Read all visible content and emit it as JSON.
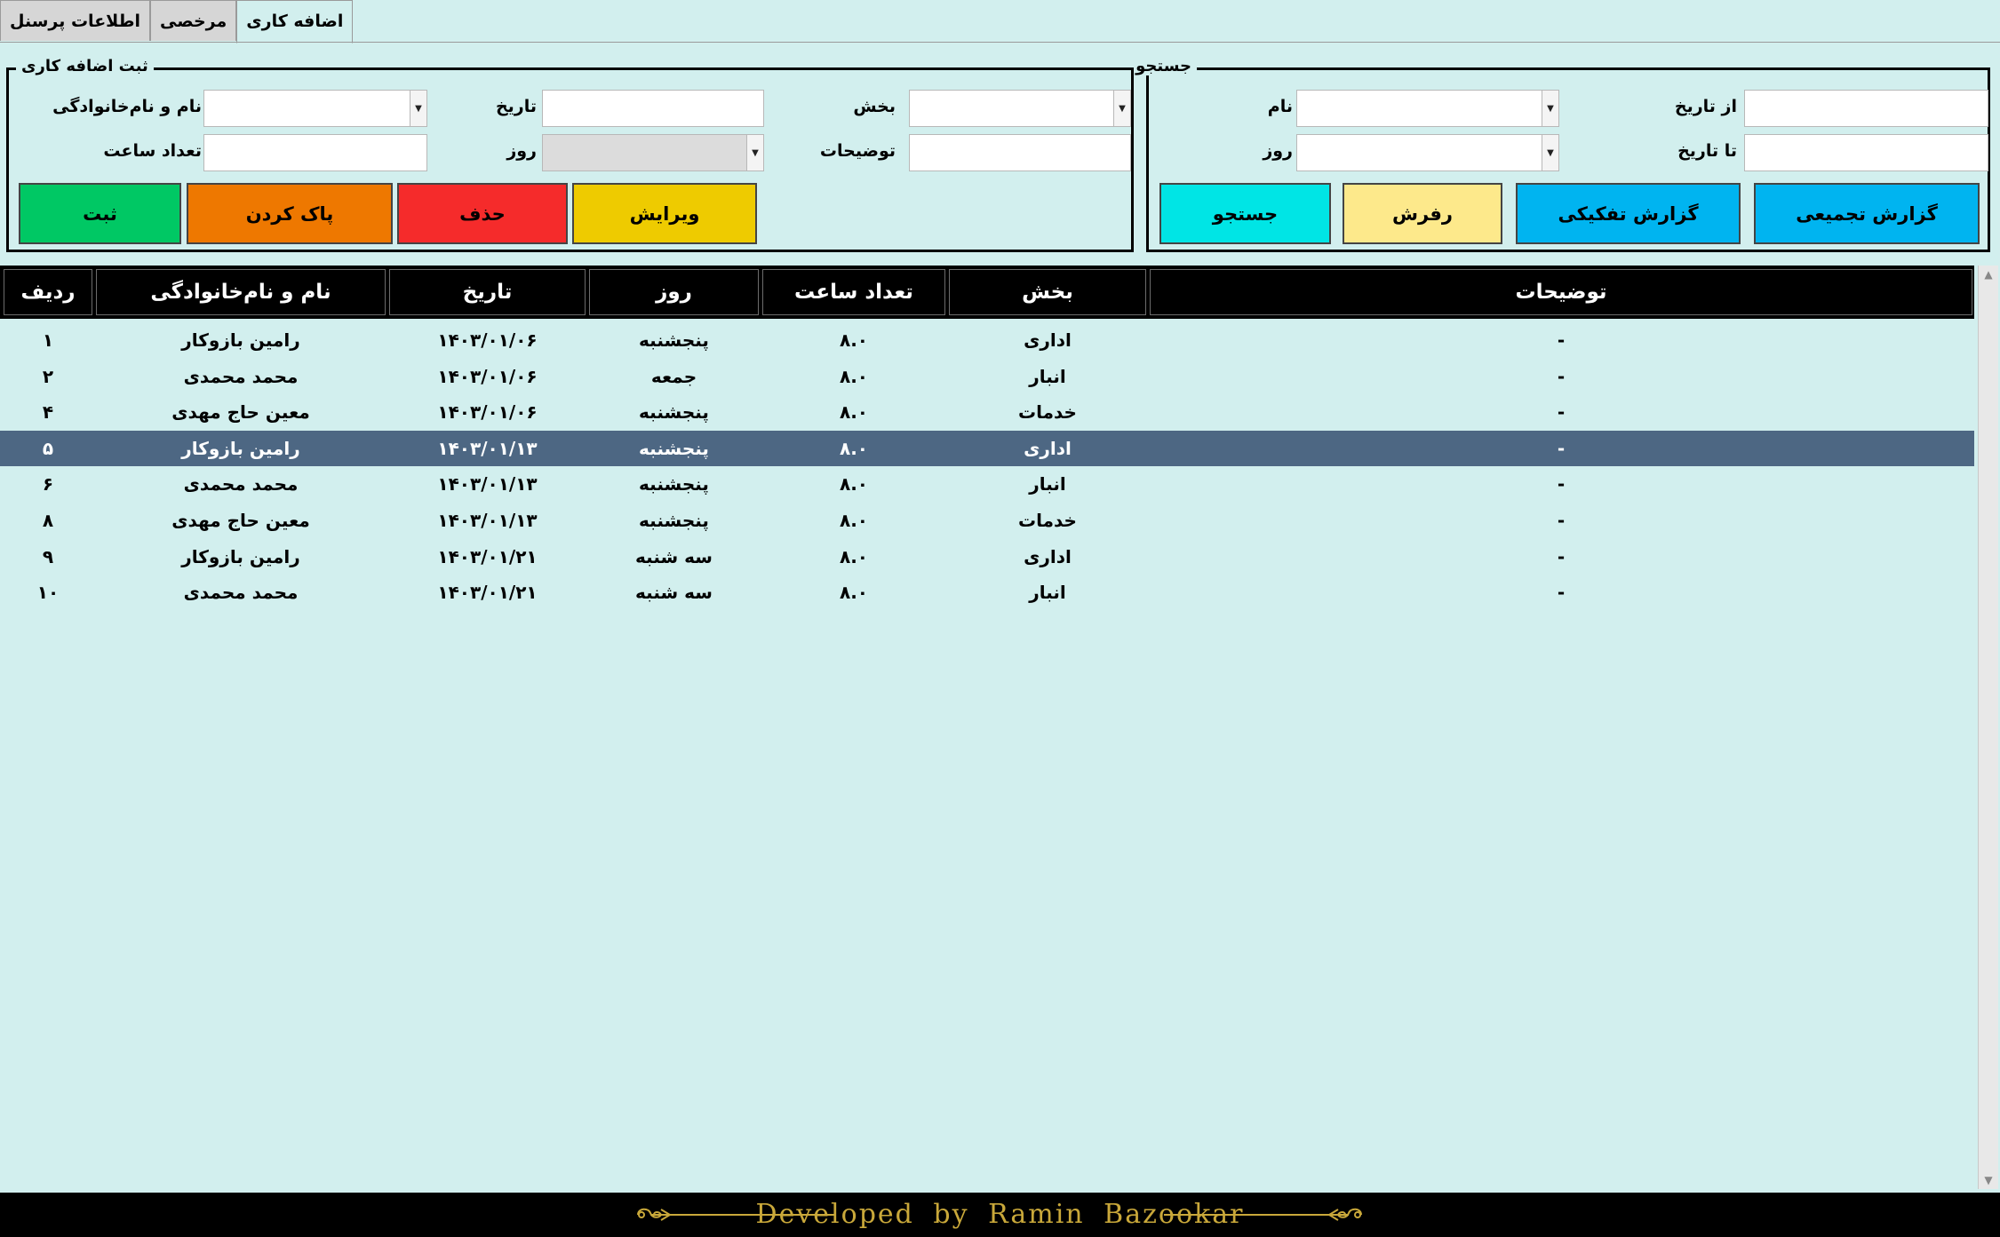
{
  "tabs": [
    {
      "label": "اطلاعات پرسنل"
    },
    {
      "label": "مرخصی"
    },
    {
      "label": "اضافه کاری"
    }
  ],
  "search": {
    "title": "جستجو",
    "from_date_label": "از تاریخ",
    "to_date_label": "تا تاریخ",
    "name_label": "نام",
    "day_label": "روز",
    "from_date_value": "",
    "to_date_value": "",
    "name_value": "",
    "day_value": "",
    "buttons": {
      "summary": "گزارش تجمیعی",
      "detailed": "گزارش تفکیکی",
      "refresh": "رفرش",
      "search": "جستجو"
    },
    "colors": {
      "summary": "#00b4f0",
      "detailed": "#00b4f0",
      "refresh": "#fde98b",
      "search": "#00e5e5"
    }
  },
  "entry": {
    "title": "ثبت اضافه کاری",
    "dept_label": "بخش",
    "desc_label": "توضیحات",
    "date_label": "تاریخ",
    "day_label": "روز",
    "name_label": "نام و نام‌خانوادگی",
    "hours_label": "تعداد ساعت",
    "dept_value": "",
    "desc_value": "",
    "date_value": "",
    "day_value": "",
    "name_value": "",
    "hours_value": "",
    "buttons": {
      "edit": "ویرایش",
      "delete": "حذف",
      "clear": "پاک کردن",
      "submit": "ثبت"
    },
    "colors": {
      "edit": "#eecb00",
      "delete": "#f52b2b",
      "clear": "#ee7800",
      "submit": "#00c864"
    }
  },
  "table": {
    "columns": {
      "desc": "توضیحات",
      "dept": "بخش",
      "hours": "تعداد ساعت",
      "day": "روز",
      "date": "تاریخ",
      "name": "نام و نام‌خانوادگی",
      "row": "ردیف"
    },
    "rows": [
      {
        "desc": "-",
        "dept": "اداری",
        "hours": "۸.۰",
        "day": "پنجشنبه",
        "date": "۱۴۰۳/۰۱/۰۶",
        "name": "رامین بازوکار",
        "row": "۱"
      },
      {
        "desc": "-",
        "dept": "انبار",
        "hours": "۸.۰",
        "day": "جمعه",
        "date": "۱۴۰۳/۰۱/۰۶",
        "name": "محمد محمدی",
        "row": "۲"
      },
      {
        "desc": "-",
        "dept": "خدمات",
        "hours": "۸.۰",
        "day": "پنجشنبه",
        "date": "۱۴۰۳/۰۱/۰۶",
        "name": "معین حاج مهدی",
        "row": "۴"
      },
      {
        "desc": "-",
        "dept": "اداری",
        "hours": "۸.۰",
        "day": "پنجشنبه",
        "date": "۱۴۰۳/۰۱/۱۳",
        "name": "رامین بازوکار",
        "row": "۵",
        "selected": true
      },
      {
        "desc": "-",
        "dept": "انبار",
        "hours": "۸.۰",
        "day": "پنجشنبه",
        "date": "۱۴۰۳/۰۱/۱۳",
        "name": "محمد محمدی",
        "row": "۶"
      },
      {
        "desc": "-",
        "dept": "خدمات",
        "hours": "۸.۰",
        "day": "پنجشنبه",
        "date": "۱۴۰۳/۰۱/۱۳",
        "name": "معین حاج مهدی",
        "row": "۸"
      },
      {
        "desc": "-",
        "dept": "اداری",
        "hours": "۸.۰",
        "day": "سه شنبه",
        "date": "۱۴۰۳/۰۱/۲۱",
        "name": "رامین بازوکار",
        "row": "۹"
      },
      {
        "desc": "-",
        "dept": "انبار",
        "hours": "۸.۰",
        "day": "سه شنبه",
        "date": "۱۴۰۳/۰۱/۲۱",
        "name": "محمد محمدی",
        "row": "۱۰"
      }
    ]
  },
  "footer": {
    "text": "Developed by Ramin Bazookar",
    "color": "#c9a83a"
  },
  "colors": {
    "background": "#d2efee",
    "selected_row": "#4d6783",
    "header": "#000000"
  }
}
